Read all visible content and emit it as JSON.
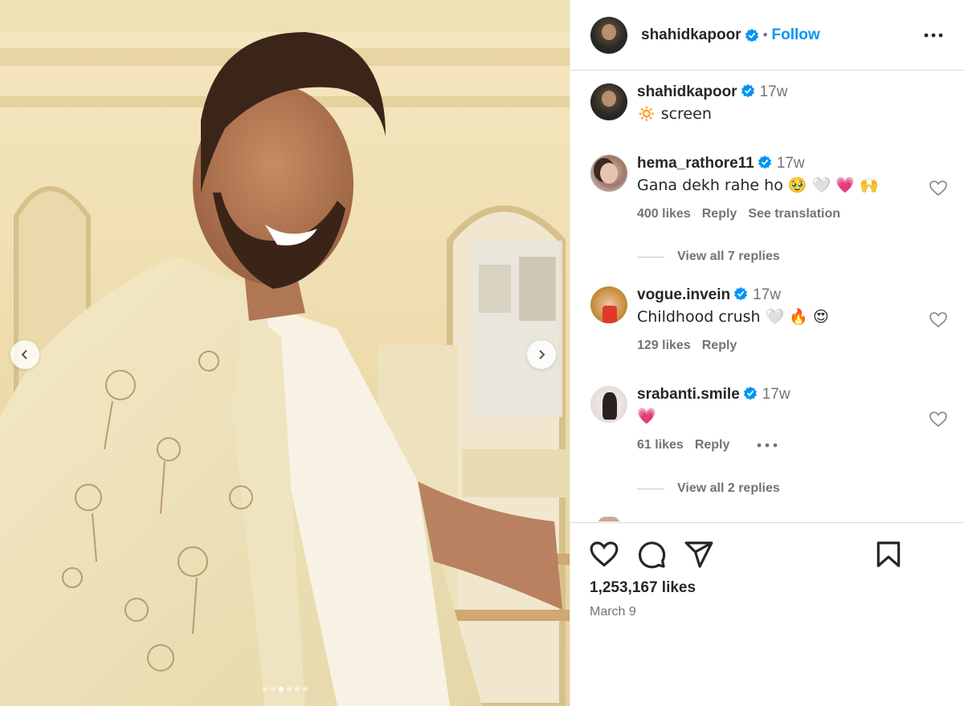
{
  "post": {
    "username": "shahidkapoor",
    "follow_label": "Follow",
    "separator": "•",
    "caption_user": "shahidkapoor",
    "caption_time": "17w",
    "caption_text": "🔅 screen",
    "carousel": {
      "count": 6,
      "active_index": 2
    }
  },
  "comments": [
    {
      "username": "hema_rathore11",
      "time": "17w",
      "text": "Gana dekh rahe ho 🥹 🤍 💗 🙌",
      "likes": "400 likes",
      "reply_label": "Reply",
      "translation_label": "See translation",
      "view_replies": "View all 7 replies"
    },
    {
      "username": "vogue.invein",
      "time": "17w",
      "text": "Childhood crush 🤍 🔥 😍",
      "likes": "129 likes",
      "reply_label": "Reply"
    },
    {
      "username": "srabanti.smile",
      "time": "17w",
      "text": "💗",
      "likes": "61 likes",
      "reply_label": "Reply",
      "view_replies": "View all 2 replies"
    }
  ],
  "footer": {
    "likes": "1,253,167 likes",
    "date": "March 9"
  },
  "colors": {
    "accent": "#0095f6",
    "verified": "#0095f6",
    "muted": "#737373",
    "text": "#262626"
  },
  "icons": [
    "chevron-left-icon",
    "chevron-right-icon",
    "more-icon",
    "verified-icon",
    "heart-icon",
    "comment-icon",
    "share-icon",
    "bookmark-icon"
  ]
}
